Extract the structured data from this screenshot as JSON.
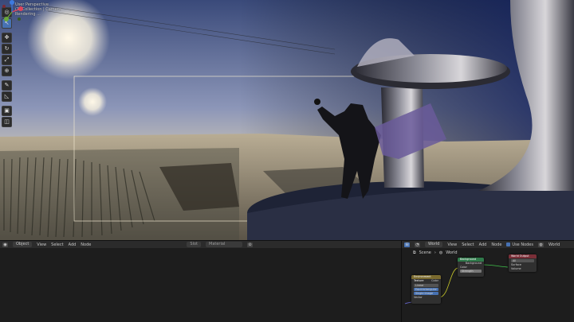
{
  "viewport": {
    "overlay_line1": "User Perspective",
    "overlay_line2": "(1) Collection | Camera",
    "overlay_line3": "Rendering ..."
  },
  "tools": [
    {
      "name": "cursor-tool-icon",
      "glyph": "◎"
    },
    {
      "name": "select-tool-icon",
      "glyph": "↖"
    },
    {
      "name": "move-tool-icon",
      "glyph": "✥"
    },
    {
      "name": "rotate-tool-icon",
      "glyph": "↻"
    },
    {
      "name": "scale-tool-icon",
      "glyph": "⤢"
    },
    {
      "name": "transform-tool-icon",
      "glyph": "⊕"
    },
    {
      "name": "annotate-tool-icon",
      "glyph": "✎"
    },
    {
      "name": "measure-tool-icon",
      "glyph": "◺"
    },
    {
      "name": "add-cube-tool-icon",
      "glyph": "▣"
    },
    {
      "name": "camera-tool-icon",
      "glyph": "◫"
    }
  ],
  "left_header": {
    "mode": "Object",
    "menus": [
      "View",
      "Select",
      "Add",
      "Node"
    ],
    "slot": "Slot",
    "material": "Material"
  },
  "right_header": {
    "type": "World",
    "menus": [
      "View",
      "Select",
      "Add",
      "Node"
    ],
    "use_nodes": "Use Nodes",
    "world": "World"
  },
  "breadcrumb": {
    "scene": "Scene",
    "world": "World"
  },
  "nodes": {
    "background": {
      "title": "Background",
      "output": "Background",
      "input1": "Color",
      "input2": "Strength"
    },
    "world_output": {
      "title": "World Output",
      "opt": "All",
      "input1": "Surface",
      "input2": "Volume"
    },
    "sky": {
      "title": "Environment Texture",
      "rows": [
        "Linear",
        "Equirectangular",
        "Single Image"
      ],
      "output": "Color",
      "input": "Vector"
    }
  },
  "colors": {
    "active_tool": "#4772b3",
    "node_shader_header": "#2f7a4a",
    "node_output_header": "#7a2f38",
    "node_texture_header": "#7a6a2f"
  }
}
